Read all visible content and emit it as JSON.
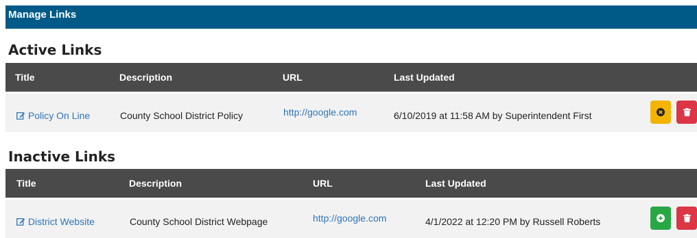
{
  "panel": {
    "title": "Manage Links"
  },
  "active": {
    "title": "Active Links",
    "columns": [
      "Title",
      "Description",
      "URL",
      "Last Updated"
    ],
    "rows": [
      {
        "title": "Policy On Line",
        "description": "County School District Policy",
        "url": "http://google.com",
        "updated": "6/10/2019 at 11:58 AM by Superintendent First"
      }
    ]
  },
  "inactive": {
    "title": "Inactive Links",
    "columns": [
      "Title",
      "Description",
      "URL",
      "Last Updated"
    ],
    "rows": [
      {
        "title": "District Website",
        "description": "County School District Webpage",
        "url": "http://google.com",
        "updated": "4/1/2022 at 12:20 PM by Russell Roberts"
      }
    ]
  },
  "colors": {
    "header": "#005a87",
    "table_head": "#4a4a4a",
    "warning": "#f4b400",
    "danger": "#dc3545",
    "success": "#28a745",
    "link": "#2e76b7"
  },
  "icons": {
    "edit": "edit-icon",
    "deactivate": "times-circle-icon",
    "delete": "trash-icon",
    "activate": "plus-circle-icon"
  }
}
